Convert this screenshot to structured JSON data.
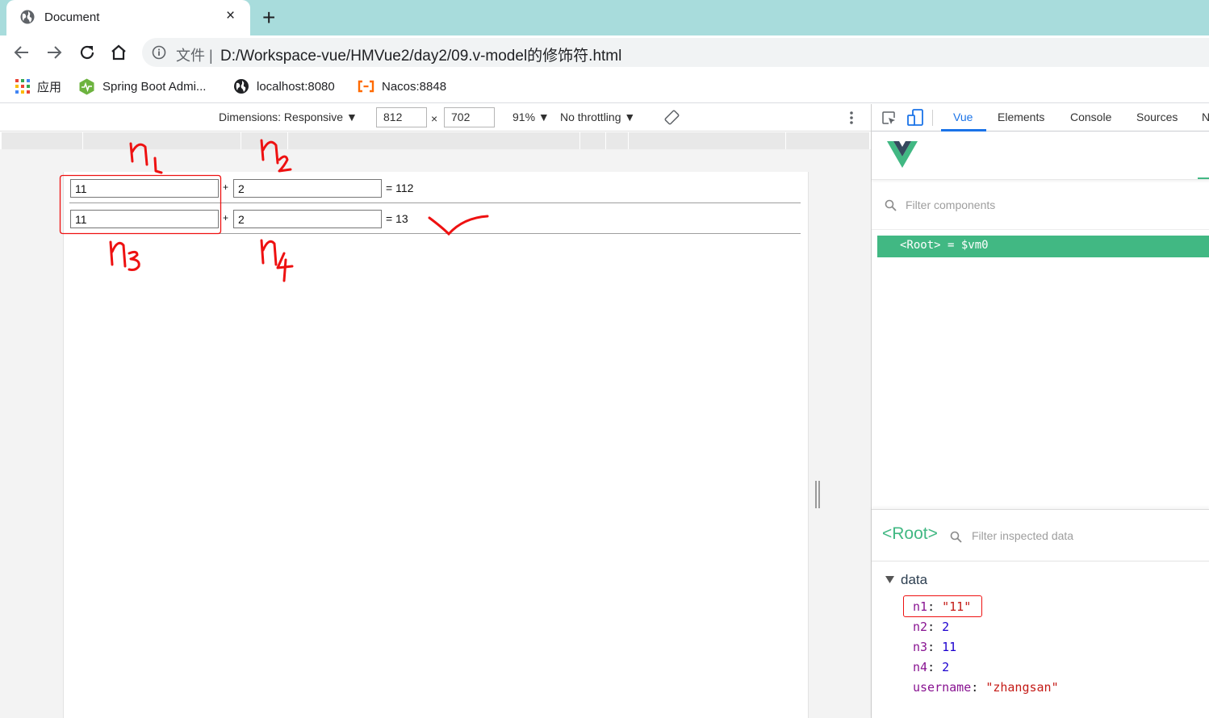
{
  "browser": {
    "tab_title": "Document",
    "tab_close": "×",
    "new_tab": "+",
    "address_scheme": "文件  |",
    "address_url": "D:/Workspace-vue/HMVue2/day2/09.v-model的修饰符.html",
    "bookmarks": [
      {
        "label": "应用",
        "icon": "apps-grid-icon"
      },
      {
        "label": "Spring Boot Admi...",
        "icon": "spring-boot-admin-icon"
      },
      {
        "label": "localhost:8080",
        "icon": "globe-icon"
      },
      {
        "label": "Nacos:8848",
        "icon": "nacos-icon"
      }
    ]
  },
  "device_toolbar": {
    "dimensions_label": "Dimensions: Responsive ▼",
    "width": "812",
    "times": "×",
    "height": "702",
    "zoom": "91% ▼",
    "throttling": "No throttling ▼"
  },
  "page": {
    "rows": [
      {
        "a": "11",
        "plus": "+",
        "b": "2",
        "result": "= 112"
      },
      {
        "a": "11",
        "plus": "+",
        "b": "2",
        "result": "= 13"
      }
    ]
  },
  "annotations": {
    "labels": [
      "n1",
      "n2",
      "n3",
      "n4"
    ],
    "color": "#ee1111"
  },
  "devtools": {
    "tabs": [
      "Vue",
      "Elements",
      "Console",
      "Sources",
      "N"
    ],
    "filter_components_placeholder": "Filter components",
    "root_component": "<Root> = $vm0",
    "inspector_root": "<Root>",
    "filter_data_placeholder": "Filter inspected data",
    "data_section": "data",
    "data": [
      {
        "key": "n1",
        "value": "\"11\"",
        "type": "string"
      },
      {
        "key": "n2",
        "value": "2",
        "type": "number"
      },
      {
        "key": "n3",
        "value": "11",
        "type": "number"
      },
      {
        "key": "n4",
        "value": "2",
        "type": "number"
      },
      {
        "key": "username",
        "value": "\"zhangsan\"",
        "type": "string"
      }
    ]
  },
  "colors": {
    "tabstrip": "#a8dcdc",
    "vue_green": "#41b883",
    "devtools_accent": "#1a73e8"
  }
}
